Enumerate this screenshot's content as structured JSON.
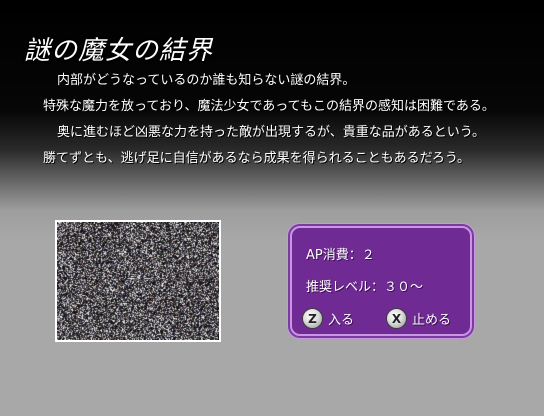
{
  "area": {
    "title": "謎の魔女の結界",
    "description": [
      "内部がどうなっているのか誰も知らない謎の結界。",
      "特殊な魔力を放っており、魔法少女であってもこの結界の感知は困難である。",
      "奥に進むほど凶悪な力を持った敵が出現するが、貴重な品があるという。",
      "勝てずとも、逃げ足に自信があるなら成果を得られることもあるだろう。"
    ]
  },
  "info": {
    "ap_cost": "AP消費：２",
    "recommended_level": "推奨レベル：３０～"
  },
  "buttons": {
    "enter": {
      "key": "Z",
      "label": "入る",
      "icon": "z-key-icon"
    },
    "stop": {
      "key": "X",
      "label": "止める",
      "icon": "x-key-icon"
    }
  },
  "colors": {
    "panel": "#6f2a93",
    "panel_border": "#c996e4",
    "background": "#a8a8a8"
  }
}
